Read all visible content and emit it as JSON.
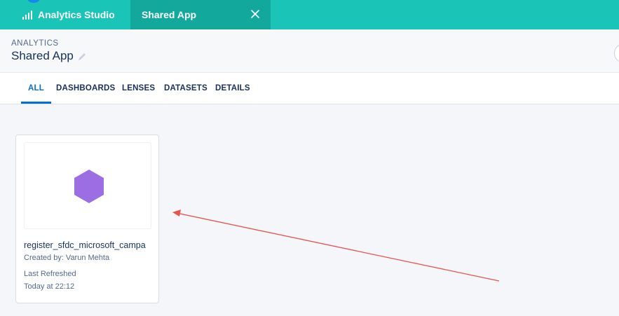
{
  "tabs": {
    "app_label": "Analytics Studio",
    "shared_label": "Shared App"
  },
  "header": {
    "eyebrow": "ANALYTICS",
    "title": "Shared App"
  },
  "nav": {
    "items": [
      "ALL",
      "DASHBOARDS",
      "LENSES",
      "DATASETS",
      "DETAILS"
    ],
    "active": "ALL"
  },
  "card": {
    "name": "register_sfdc_microsoft_campa",
    "created_by": "Created by: Varun Mehta",
    "refreshed_label": "Last Refreshed",
    "refreshed_value": "Today at 22:12"
  },
  "colors": {
    "tabbar": "#1ac4b6",
    "tab_active": "#12a99c",
    "accent": "#0070d2",
    "hexagon": "#9b6ee3",
    "annotation_arrow": "#e8524f"
  }
}
